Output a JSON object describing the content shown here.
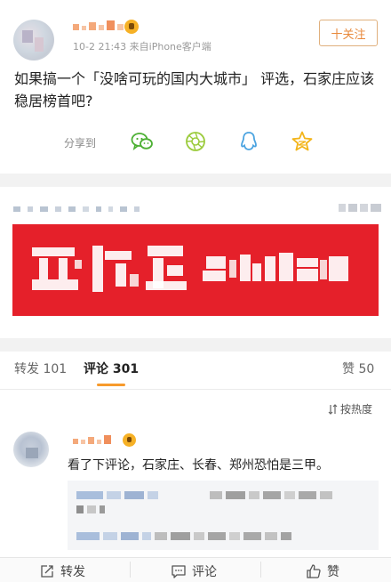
{
  "post": {
    "meta": "10-2 21:43  来自iPhone客户端",
    "follow_label": "十关注",
    "text": "如果搞一个「没啥可玩的国内大城市」 评选，石家庄应该稳居榜首吧?",
    "share_label": "分享到",
    "share_icons": [
      "wechat-icon",
      "moments-icon",
      "qq-icon",
      "qzone-icon"
    ]
  },
  "tabs": {
    "repost_label": "转发",
    "repost_count": "101",
    "comment_label": "评论",
    "comment_count": "301",
    "like_label": "赞",
    "like_count": "50"
  },
  "sort": {
    "label": "按热度"
  },
  "comment": {
    "text": "看了下评论，石家庄、长春、郑州恐怕是三甲。"
  },
  "bottom_bar": {
    "repost": "转发",
    "comment": "评论",
    "like": "赞"
  },
  "colors": {
    "accent_orange": "#f79a2c",
    "follow_orange": "#e8883a",
    "banner_red": "#e5202a",
    "wechat_green": "#4cb033",
    "moments_green": "#9bcb3c",
    "qq_blue": "#4aa3e0",
    "qzone_yellow": "#f3b51b"
  }
}
